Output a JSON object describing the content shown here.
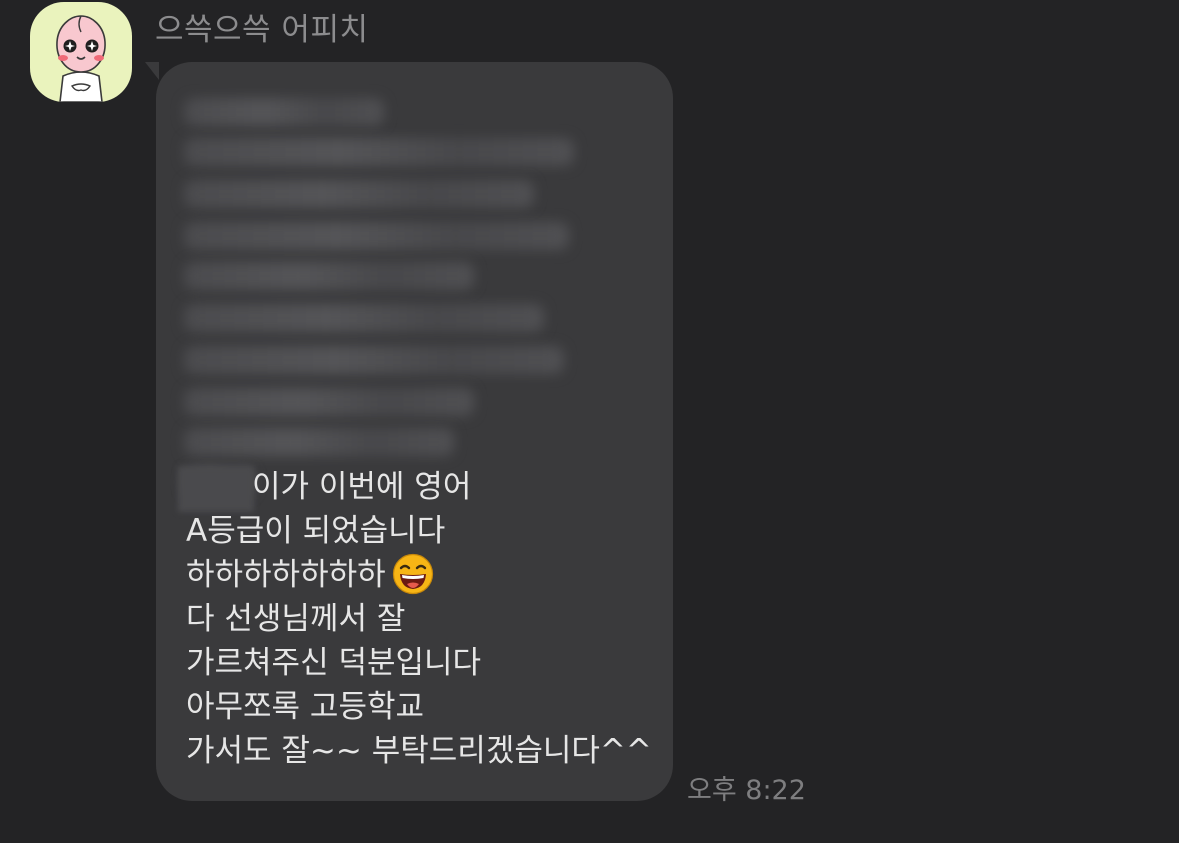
{
  "chat": {
    "sender_name": "으쓱으쓱 어피치",
    "avatar_icon": "apeach-character-icon",
    "message": {
      "blurred_content": "redacted",
      "lines": [
        "이가 이번에 영어",
        "A등급이 되었습니다",
        "하하하하하하하",
        "다 선생님께서 잘",
        "가르쳐주신 덕분입니다",
        "아무쪼록 고등학교",
        "가서도 잘~~ 부탁드리겠습니다^^"
      ],
      "emoji": "grinning-laughing-emoji",
      "timestamp": "오후 8:22"
    },
    "colors": {
      "background": "#232325",
      "bubble": "#3a3a3c",
      "avatar_bg": "#eaf3bd",
      "text": "#e6e6e6",
      "muted_text": "#8c8c8e"
    }
  }
}
